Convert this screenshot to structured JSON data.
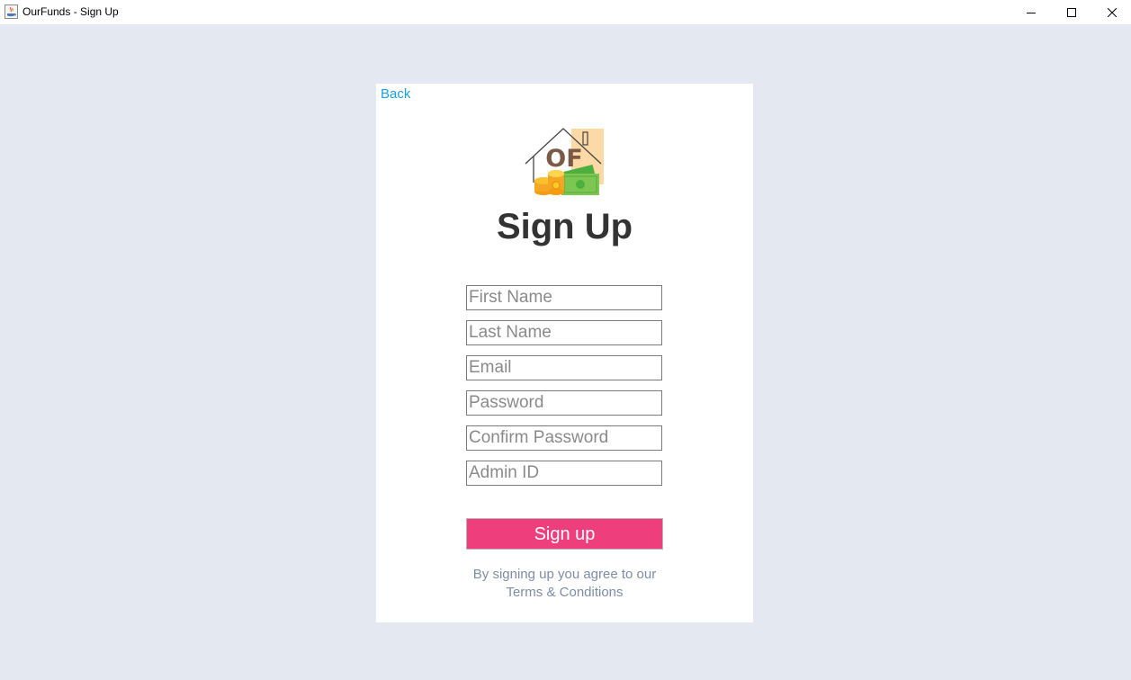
{
  "window": {
    "title": "OurFunds - Sign Up",
    "controls": [
      "minimize",
      "maximize",
      "close"
    ]
  },
  "nav": {
    "back_label": "Back"
  },
  "logo": {
    "text": "OF",
    "icon": "ourfunds-logo-icon"
  },
  "form": {
    "title": "Sign Up",
    "fields": [
      {
        "name": "first-name",
        "placeholder": "First Name",
        "value": ""
      },
      {
        "name": "last-name",
        "placeholder": "Last Name",
        "value": ""
      },
      {
        "name": "email",
        "placeholder": "Email",
        "value": ""
      },
      {
        "name": "password",
        "placeholder": "Password",
        "value": ""
      },
      {
        "name": "confirm-password",
        "placeholder": "Confirm Password",
        "value": ""
      },
      {
        "name": "admin-id",
        "placeholder": "Admin ID",
        "value": ""
      }
    ],
    "submit_label": "Sign up",
    "terms_line1": "By signing up you agree to our",
    "terms_link": "Terms & Conditions"
  },
  "colors": {
    "background": "#e4e9f1",
    "card": "#ffffff",
    "link": "#1a9fdc",
    "button": "#ee3e7b",
    "heading": "#333333",
    "muted": "#7e8da4"
  }
}
